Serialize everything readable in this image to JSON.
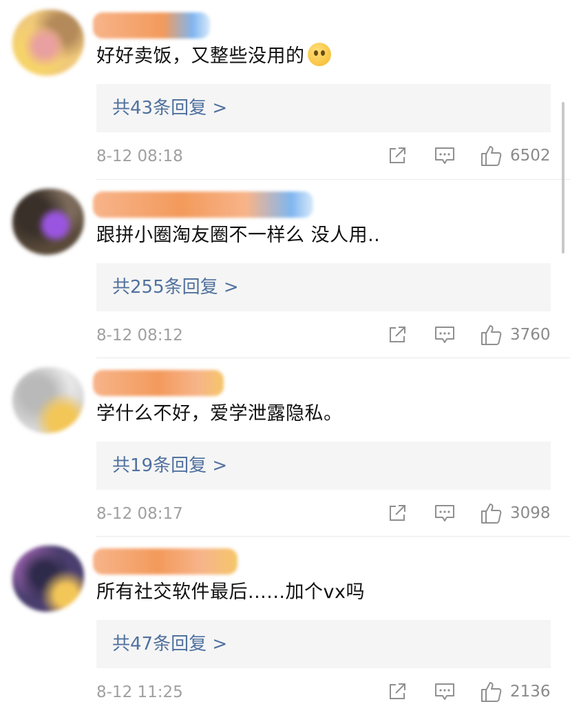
{
  "comments": [
    {
      "text": "好好卖饭，又整些没用的",
      "emoji": "drooling-face-emoji",
      "reply_label": "共43条回复 >",
      "time": "8-12 08:18",
      "likes": "6502",
      "colors": {
        "avatar": [
          "#f0c97a",
          "#e9a0a0",
          "#f6d36a",
          "#b48a5a"
        ],
        "name": [
          "#f7b48a",
          "#f39a5c",
          "#7fb6f0"
        ]
      }
    },
    {
      "text": "跟拼小圈淘友圈不一样么 没人用..",
      "reply_label": "共255条回复 >",
      "time": "8-12 08:12",
      "likes": "3760",
      "colors": {
        "avatar": [
          "#5a4a3a",
          "#9a55e0",
          "#7b6a5a",
          "#3a302a"
        ],
        "name": [
          "#f7b48a",
          "#f39a5c",
          "#7fb6f0"
        ]
      }
    },
    {
      "text": "学什么不好，爱学泄露隐私。",
      "reply_label": "共19条回复 >",
      "time": "8-12 08:17",
      "likes": "3098",
      "colors": {
        "avatar": [
          "#d6d6d6",
          "#b9b9b9",
          "#f3c658",
          "#e8e8e8"
        ],
        "name": [
          "#f7b48a",
          "#f39a5c",
          "#f5c66a"
        ]
      }
    },
    {
      "text": "所有社交软件最后......加个vx吗",
      "reply_label": "共47条回复 >",
      "time": "8-12 11:25",
      "likes": "2136",
      "colors": {
        "avatar": [
          "#4a3e6e",
          "#8a5aa0",
          "#f3c658",
          "#2e2a4a"
        ],
        "name": [
          "#f7b48a",
          "#f39a5c",
          "#f5c66a"
        ]
      }
    }
  ]
}
